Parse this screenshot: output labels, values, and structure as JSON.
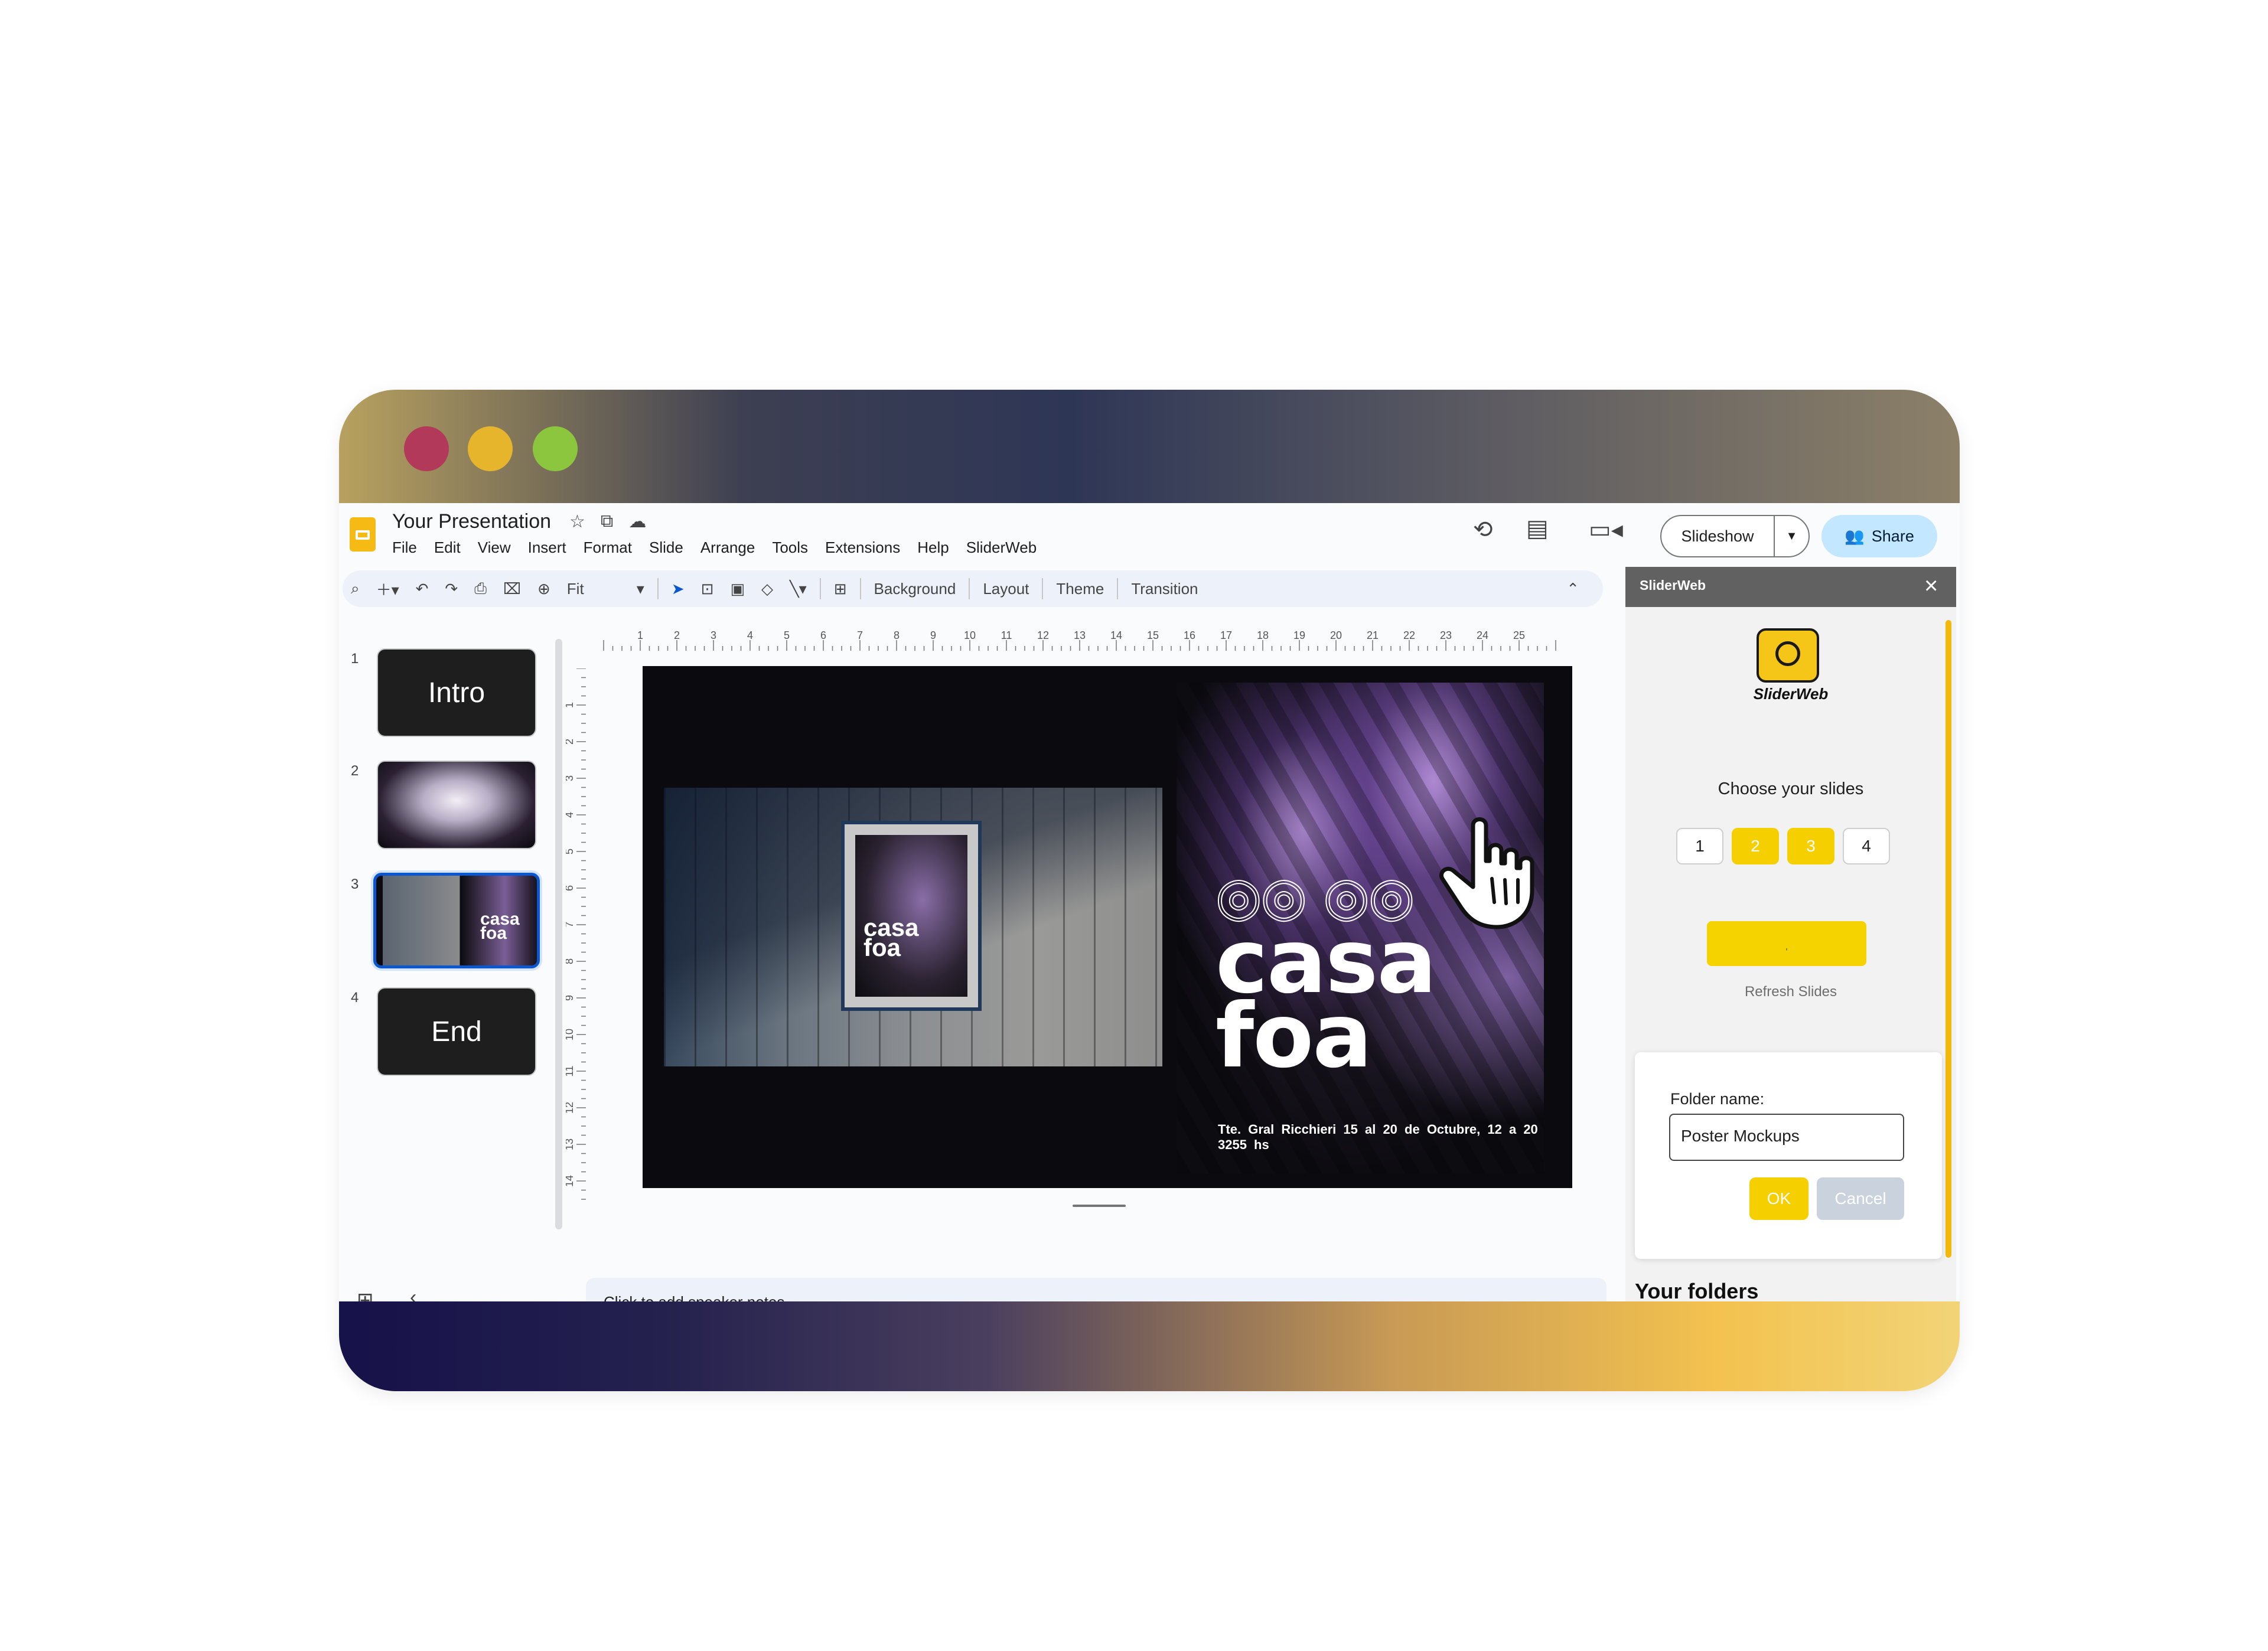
{
  "window": {
    "dots": [
      "#b3395a",
      "#e7b52c",
      "#8cc63f"
    ]
  },
  "header": {
    "doc_title": "Your Presentation",
    "menu": [
      "File",
      "Edit",
      "View",
      "Insert",
      "Format",
      "Slide",
      "Arrange",
      "Tools",
      "Extensions",
      "Help",
      "SliderWeb"
    ],
    "slideshow_label": "Slideshow",
    "share_label": "Share"
  },
  "toolbar": {
    "zoom_label": "Fit",
    "background_label": "Background",
    "layout_label": "Layout",
    "theme_label": "Theme",
    "transition_label": "Transition"
  },
  "ruler": {
    "h_ticks": [
      "1",
      "2",
      "3",
      "4",
      "5",
      "6",
      "7",
      "8",
      "9",
      "10",
      "11",
      "12",
      "13",
      "14",
      "15",
      "16",
      "17",
      "18",
      "19",
      "20",
      "21",
      "22",
      "23",
      "24",
      "25"
    ],
    "v_ticks": [
      "1",
      "2",
      "3",
      "4",
      "5",
      "6",
      "7",
      "8",
      "9",
      "10",
      "11",
      "12",
      "13",
      "14"
    ]
  },
  "filmstrip": {
    "slides": [
      {
        "num": "1",
        "label": "Intro"
      },
      {
        "num": "2",
        "label": ""
      },
      {
        "num": "3",
        "label": ""
      },
      {
        "num": "4",
        "label": "End"
      }
    ]
  },
  "slide": {
    "poster_title_line1": "casa",
    "poster_title_line2": "foa",
    "poster_footer": "Tte. Gral Ricchieri 15 al 20 de Octubre, 12 a 20 3255 hs",
    "mini_title_line1": "casa",
    "mini_title_line2": "foa"
  },
  "notes": {
    "placeholder": "Click to add speaker notes"
  },
  "panel": {
    "title": "SliderWeb",
    "brand": "SliderWeb",
    "choose_label": "Choose your slides",
    "slide_numbers": [
      {
        "label": "1",
        "selected": false
      },
      {
        "label": "2",
        "selected": true
      },
      {
        "label": "3",
        "selected": true
      },
      {
        "label": "4",
        "selected": false
      }
    ],
    "refresh_button_text": "ˌ",
    "refresh_label": "Refresh Slides",
    "dialog": {
      "folder_label": "Folder name:",
      "folder_value": "Poster Mockups",
      "ok_label": "OK",
      "cancel_label": "Cancel"
    },
    "your_folders": "Your folders"
  },
  "colors": {
    "accent_yellow": "#f5cf00",
    "selection_blue": "#0b57d0",
    "share_bg": "#c2e7ff"
  },
  "icons": {
    "star": "star-icon",
    "move": "folder-move-icon",
    "cloud": "cloud-saved-icon",
    "history": "history-icon",
    "comments": "comment-icon",
    "meet": "video-camera-icon"
  }
}
